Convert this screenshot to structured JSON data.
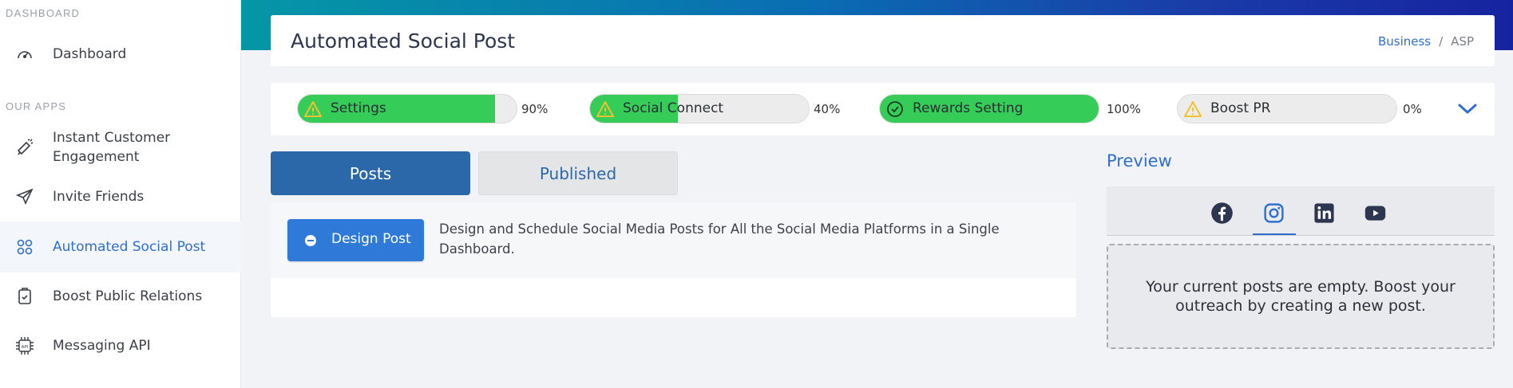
{
  "sidebar": {
    "section_dashboard": "DASHBOARD",
    "section_apps": "OUR APPS",
    "items": [
      {
        "label": "Dashboard",
        "icon": "speedometer-icon"
      },
      {
        "label": "Instant Customer Engagement",
        "icon": "megaphone-icon"
      },
      {
        "label": "Invite Friends",
        "icon": "paper-plane-icon"
      },
      {
        "label": "Automated Social Post",
        "icon": "social-grid-icon",
        "active": true
      },
      {
        "label": "Boost Public Relations",
        "icon": "badge-icon"
      },
      {
        "label": "Messaging API",
        "icon": "api-chip-icon"
      }
    ]
  },
  "header": {
    "title": "Automated Social Post",
    "breadcrumb": {
      "link": "Business",
      "separator": "/",
      "current": "ASP"
    }
  },
  "progress": [
    {
      "label": "Settings",
      "percent_text": "90%",
      "fill": 0.9,
      "status": "warning"
    },
    {
      "label": "Social Connect",
      "percent_text": "40%",
      "fill": 0.4,
      "status": "warning"
    },
    {
      "label": "Rewards Setting",
      "percent_text": "100%",
      "fill": 1.0,
      "status": "complete"
    },
    {
      "label": "Boost PR",
      "percent_text": "0%",
      "fill": 0.0,
      "status": "warning"
    }
  ],
  "tabs": {
    "posts": "Posts",
    "published": "Published",
    "active": "posts"
  },
  "posts": {
    "design_button": "Design Post",
    "description": "Design and Schedule Social Media Posts for All the Social Media Platforms in a Single Dashboard."
  },
  "preview": {
    "title": "Preview",
    "platforms": [
      "facebook-icon",
      "instagram-icon",
      "linkedin-icon",
      "youtube-icon"
    ],
    "active_platform": "instagram-icon",
    "empty_message": "Your current posts are empty. Boost your outreach by creating a new post."
  },
  "colors": {
    "accent": "#2f6fd0",
    "progress_fill": "#35cc57",
    "tab_active": "#2b68aa",
    "warning": "#f2c12e"
  }
}
